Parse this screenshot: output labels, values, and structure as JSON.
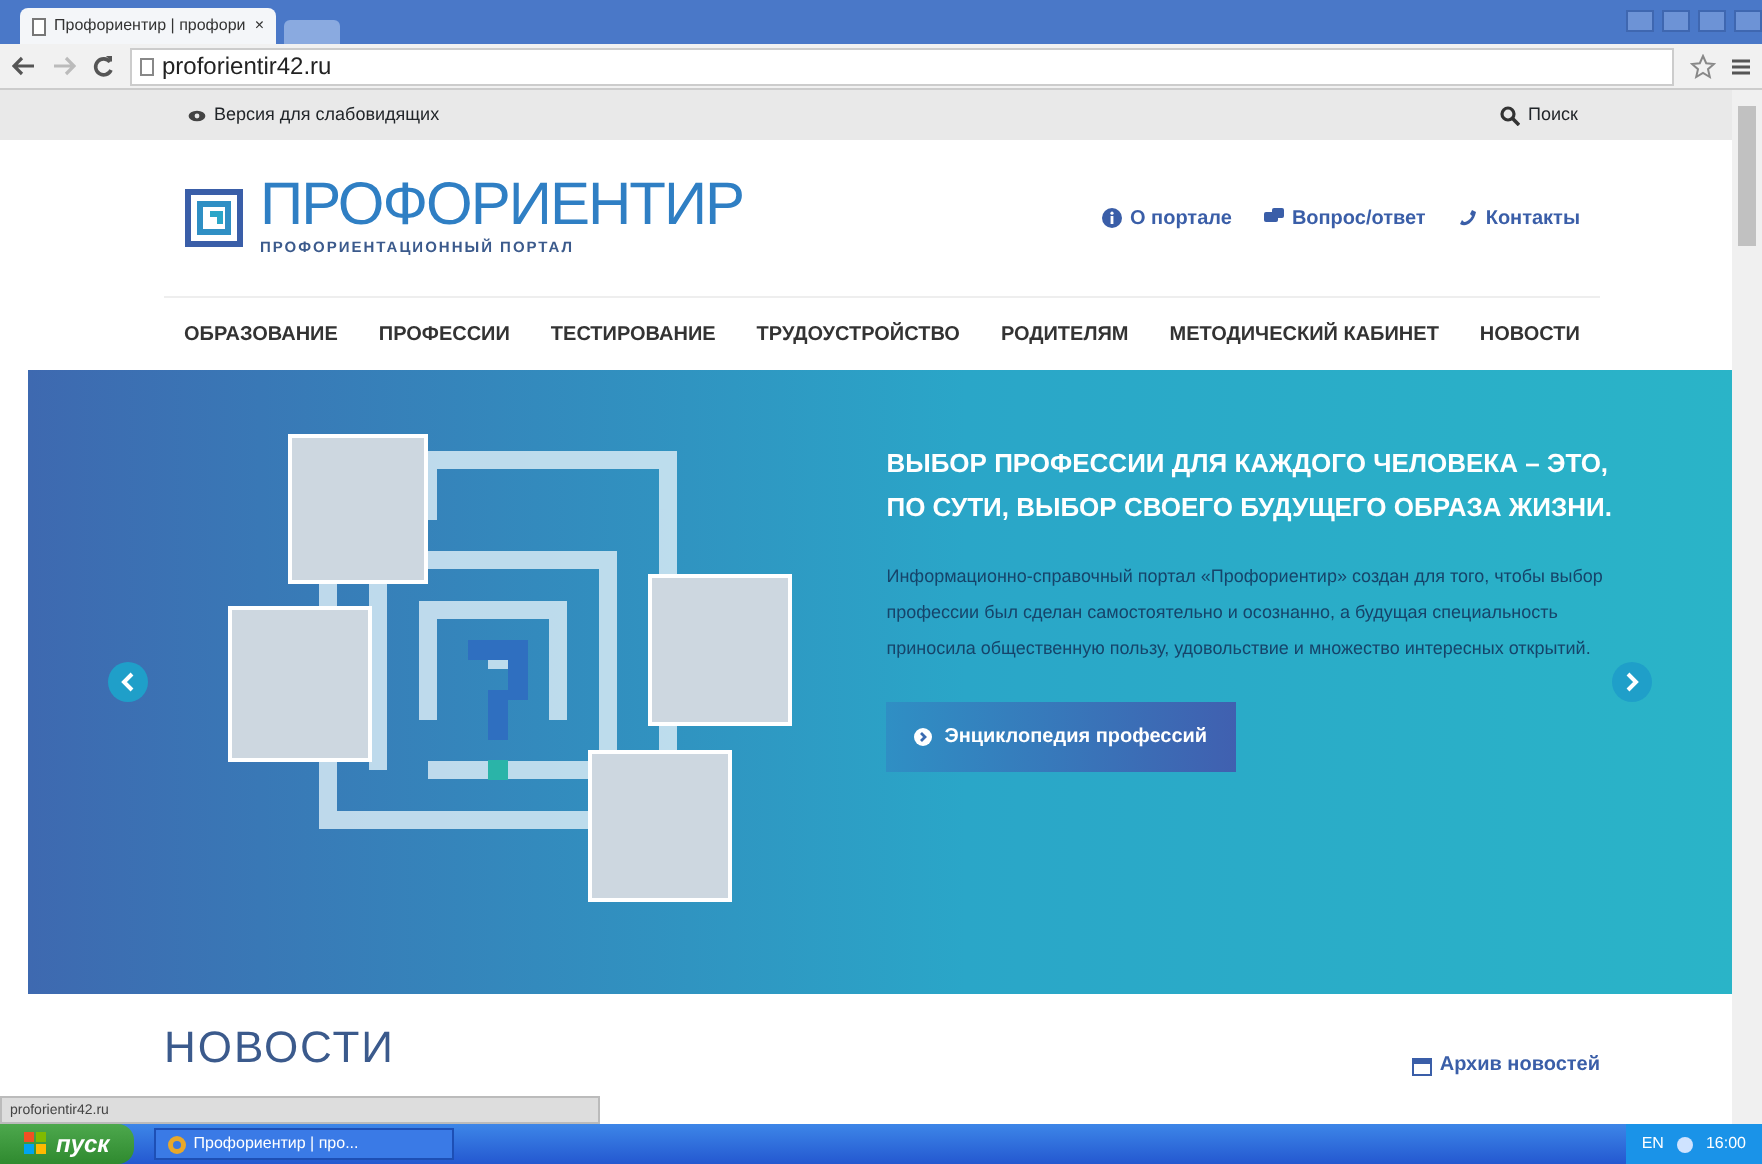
{
  "browser": {
    "tab_title": "Профориентир | профори",
    "tab_close": "×",
    "url": "proforientir42.ru",
    "status_url": "proforientir42.ru"
  },
  "site": {
    "accessibility_link": "Версия для слабовидящих",
    "search_link": "Поиск",
    "logo": {
      "title": "ПРОФОРИЕНТИР",
      "subtitle": "ПРОФОРИЕНТАЦИОННЫЙ ПОРТАЛ"
    },
    "top_links": [
      {
        "label": "О портале",
        "kind": "info"
      },
      {
        "label": "Вопрос/ответ",
        "kind": "chat"
      },
      {
        "label": "Контакты",
        "kind": "phone"
      }
    ],
    "nav": [
      "ОБРАЗОВАНИЕ",
      "ПРОФЕССИИ",
      "ТЕСТИРОВАНИЕ",
      "ТРУДОУСТРОЙСТВО",
      "РОДИТЕЛЯМ",
      "МЕТОДИЧЕСКИЙ КАБИНЕТ",
      "НОВОСТИ"
    ],
    "hero": {
      "heading": [
        "ВЫБОР ПРОФЕССИИ ДЛЯ КАЖДОГО ЧЕЛОВЕКА – ЭТО,",
        "ПО СУТИ, ВЫБОР СВОЕГО БУДУЩЕГО ОБРАЗА ЖИЗНИ."
      ],
      "text": "Информационно-справочный портал «Профориентир» создан для того, чтобы выбор профессии был сделан самостоятельно и осознанно, а будущая специальность приносила общественную пользу, удовольствие и множество интересных открытий.",
      "button": "Энциклопедия профессий"
    },
    "news": {
      "title": "НОВОСТИ",
      "archive": "Архив новостей"
    }
  },
  "taskbar": {
    "start": "пуск",
    "task": "Профориентир | про...",
    "lang": "EN",
    "clock": "16:00"
  }
}
